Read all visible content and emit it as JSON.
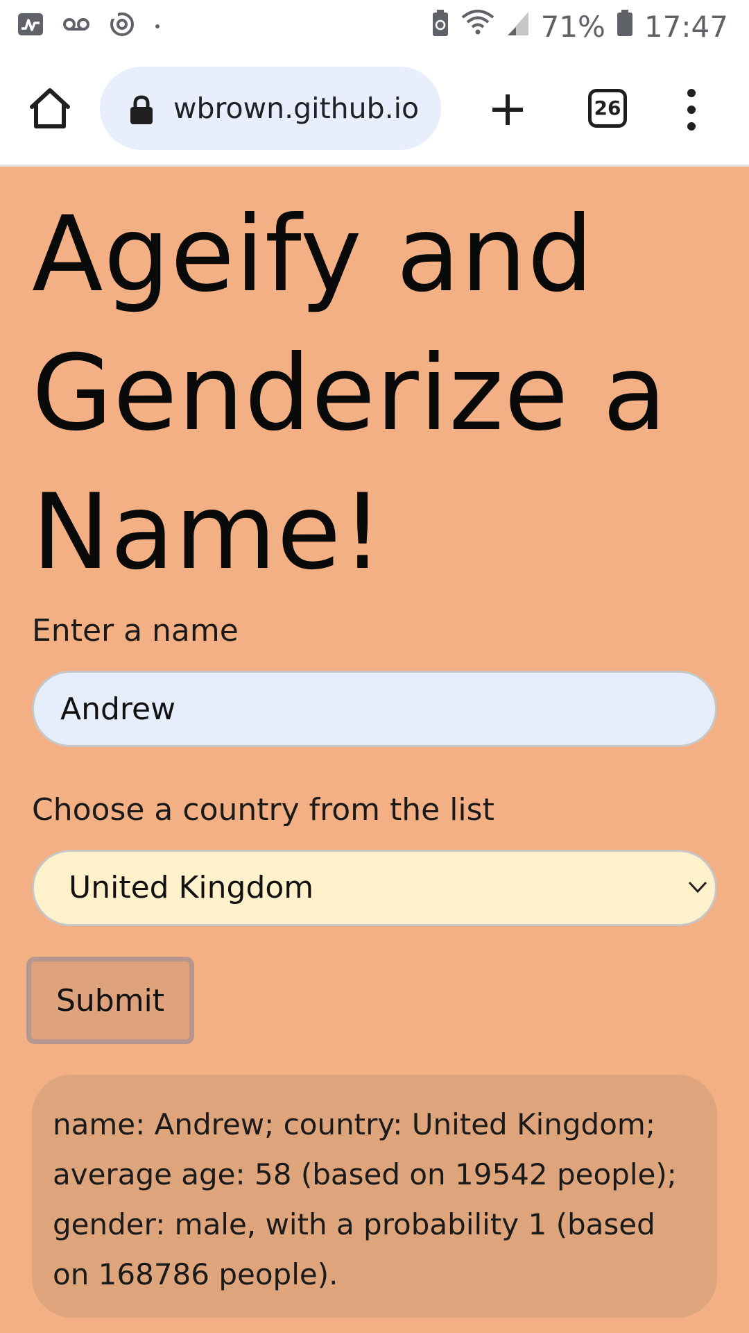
{
  "status_bar": {
    "battery_percent": "71%",
    "time": "17:47",
    "icons": [
      "activity-icon",
      "voicemail-icon",
      "sync-icon",
      "dot-icon",
      "battery-saver-icon",
      "wifi-icon",
      "signal-icon",
      "battery-icon"
    ]
  },
  "browser": {
    "url": "wbrown.github.io",
    "tab_count": "26",
    "icons": [
      "home-icon",
      "lock-icon",
      "plus-icon",
      "tabs-icon",
      "more-vert-icon"
    ]
  },
  "page": {
    "title": "Ageify and Genderize a Name!",
    "name_label": "Enter a name",
    "name_value": "Andrew",
    "country_label": "Choose a country from the list",
    "country_value": "United Kingdom",
    "submit_label": "Submit",
    "result_text": "name: Andrew; country: United Kingdom; average age: 58 (based on 19542 people); gender: male, with a probability 1 (based on 168786 people).",
    "background_color": "#f2b084"
  }
}
